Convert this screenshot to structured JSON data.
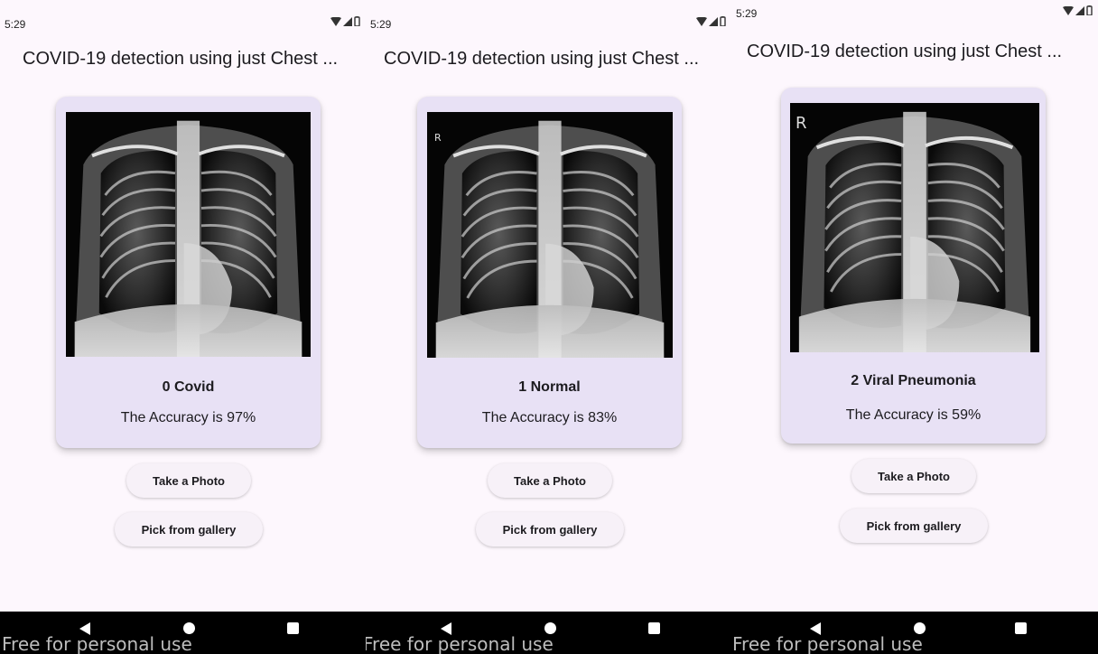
{
  "colors": {
    "screen_bg": "#fdf7fd",
    "card_bg": "#e8e1f5",
    "button_bg": "#f7f1f8",
    "nav_bar": "#000000",
    "watermark": "#bdbdbd"
  },
  "status_icons": [
    "wifi-icon",
    "signal-icon",
    "battery-icon"
  ],
  "watermark_text": "Free for personal use",
  "screens": [
    {
      "status_time": "5:29",
      "app_title": "COVID-19 detection using just Chest ...",
      "xray_marker": "",
      "result_label": "0 Covid",
      "accuracy_text": "The Accuracy is 97%",
      "take_photo_label": "Take a Photo",
      "pick_gallery_label": "Pick from gallery"
    },
    {
      "status_time": "5:29",
      "app_title": "COVID-19 detection using just Chest ...",
      "xray_marker": "R",
      "result_label": "1 Normal",
      "accuracy_text": "The Accuracy is 83%",
      "take_photo_label": "Take a Photo",
      "pick_gallery_label": "Pick from gallery"
    },
    {
      "status_time": "5:29",
      "app_title": "COVID-19 detection using just Chest ...",
      "xray_marker": "R",
      "result_label": "2 Viral Pneumonia",
      "accuracy_text": "The Accuracy is 59%",
      "take_photo_label": "Take a Photo",
      "pick_gallery_label": "Pick from gallery"
    }
  ]
}
